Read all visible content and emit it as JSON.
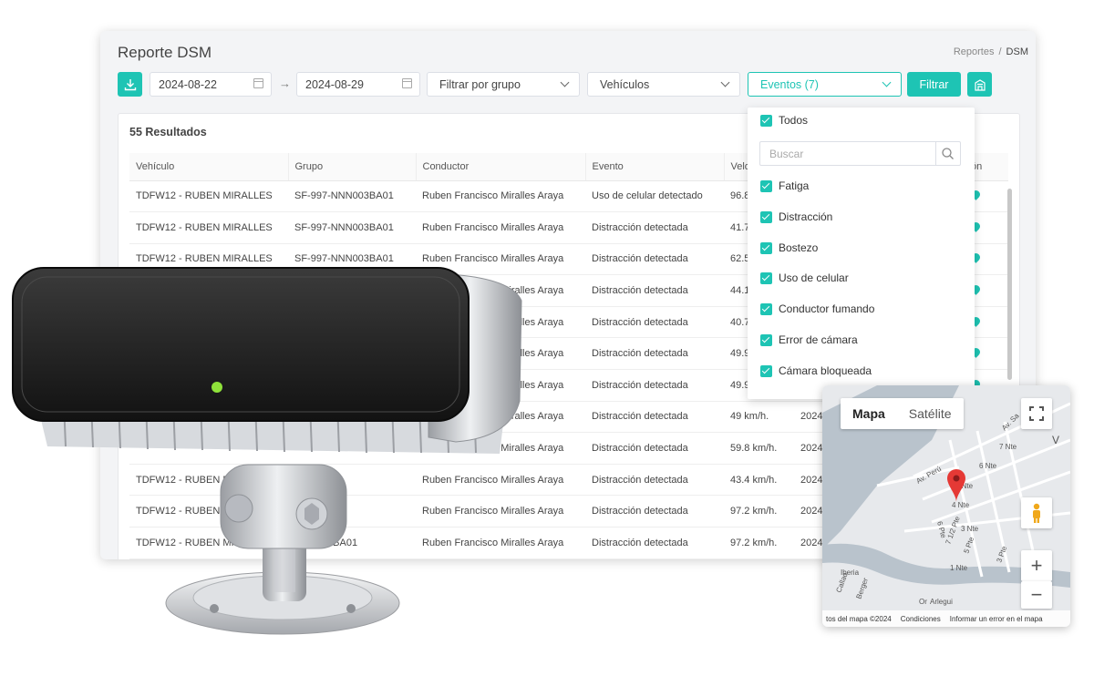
{
  "page": {
    "title": "Reporte DSM",
    "breadcrumb": [
      "Reportes",
      "DSM"
    ]
  },
  "toolbar": {
    "date_from": "2024-08-22",
    "date_arrow": "→",
    "date_to": "2024-08-29",
    "group_filter": "Filtrar por grupo",
    "vehicles_filter": "Vehículos",
    "events_filter": "Eventos (7)",
    "filter_button": "Filtrar"
  },
  "results": {
    "count_label": "55 Resultados",
    "columns": [
      "Vehículo",
      "Grupo",
      "Conductor",
      "Evento",
      "Velo",
      "",
      "cación"
    ],
    "rows": [
      [
        "TDFW12 - RUBEN MIRALLES",
        "SF-997-NNN003BA01",
        "Ruben Francisco Miralles Araya",
        "Uso de celular detectado",
        "96.8",
        ""
      ],
      [
        "TDFW12 - RUBEN MIRALLES",
        "SF-997-NNN003BA01",
        "Ruben Francisco Miralles Araya",
        "Distracción detectada",
        "41.7",
        ""
      ],
      [
        "TDFW12 - RUBEN MIRALLES",
        "SF-997-NNN003BA01",
        "Ruben Francisco Miralles Araya",
        "Distracción detectada",
        "62.5",
        ""
      ],
      [
        "",
        "",
        "Ruben Francisco Miralles Araya",
        "Distracción detectada",
        "44.1",
        ""
      ],
      [
        "",
        "",
        "Ruben Francisco Miralles Araya",
        "Distracción detectada",
        "40.7",
        ""
      ],
      [
        "",
        "",
        "Ruben Francisco Miralles Araya",
        "Distracción detectada",
        "49.9",
        ""
      ],
      [
        "",
        "",
        "Ruben Francisco Miralles Araya",
        "Distracción detectada",
        "49.9",
        ""
      ],
      [
        "",
        "",
        "Ruben Francisco Miralles Araya",
        "Distracción detectada",
        "49 km/h.",
        "2024-"
      ],
      [
        "",
        "",
        "Ruben Francisco Miralles Araya",
        "Distracción detectada",
        "59.8 km/h.",
        "2024-"
      ],
      [
        "TDFW12 - RUBEN M",
        "003BA01",
        "Ruben Francisco Miralles Araya",
        "Distracción detectada",
        "43.4 km/h.",
        "2024-"
      ],
      [
        "TDFW12 - RUBEN M",
        "003BA01",
        "Ruben Francisco Miralles Araya",
        "Distracción detectada",
        "97.2 km/h.",
        "2024-"
      ],
      [
        "TDFW12 - RUBEN MIR",
        "NNN003BA01",
        "Ruben Francisco Miralles Araya",
        "Distracción detectada",
        "97.2 km/h.",
        "2024-"
      ]
    ]
  },
  "events_dropdown": {
    "all_label": "Todos",
    "search_placeholder": "Buscar",
    "options": [
      "Fatiga",
      "Distracción",
      "Bostezo",
      "Uso de celular",
      "Conductor fumando",
      "Error de cámara",
      "Cámara bloqueada"
    ]
  },
  "map": {
    "tab_map": "Mapa",
    "tab_satellite": "Satélite",
    "zoom_in": "+",
    "zoom_out": "−",
    "footer": [
      "tos del mapa ©2024",
      "Condiciones",
      "Informar un error en el mapa"
    ],
    "street_labels": [
      "Av. Perú",
      "5 Nte",
      "4 Nte",
      "6 Nte",
      "7 Nte",
      "3 Nte",
      "1 Nte",
      "6 Pte",
      "5 Pte",
      "3 Pte",
      "Iberia",
      "Arlegui",
      "Callao",
      "Berger",
      "Av. Sa",
      "Or",
      "V",
      "7 1/2 Pte"
    ]
  },
  "colors": {
    "accent": "#1ec4b4",
    "status_led": "#8fe23a"
  }
}
